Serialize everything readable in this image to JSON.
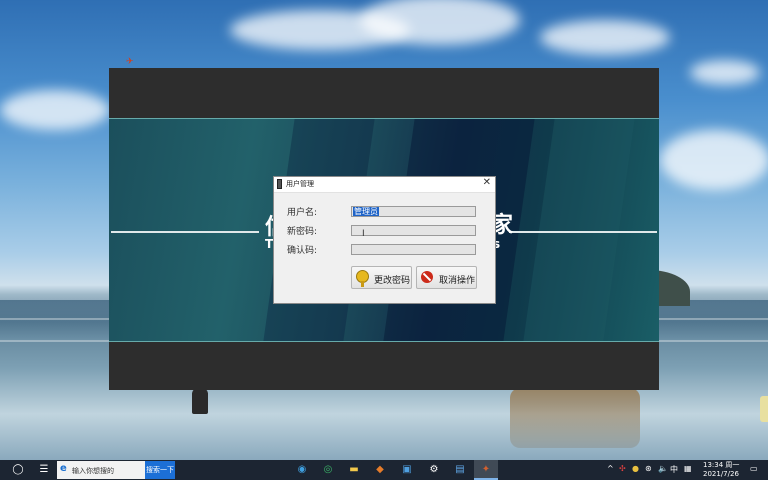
{
  "dialog": {
    "title": "用户管理",
    "username_label": "用户名:",
    "username_value": "管理员",
    "new_password_label": "新密码:",
    "confirm_label": "确认码:",
    "change_button": "更改密码",
    "cancel_button": "取消操作"
  },
  "banner": {
    "left_char": "信",
    "right_char": "家",
    "left_small": "T",
    "right_small": "s"
  },
  "taskbar": {
    "search_placeholder": "输入你想搜的",
    "search_button": "搜索一下",
    "tray_ime": "中",
    "clock_time": "13:34 周一",
    "clock_date": "2021/7/26"
  },
  "icons": {
    "start": "start-icon",
    "task_view": "task-view-icon",
    "edge": "edge-icon",
    "file_explorer": "folder-icon",
    "settings": "gear-icon"
  }
}
